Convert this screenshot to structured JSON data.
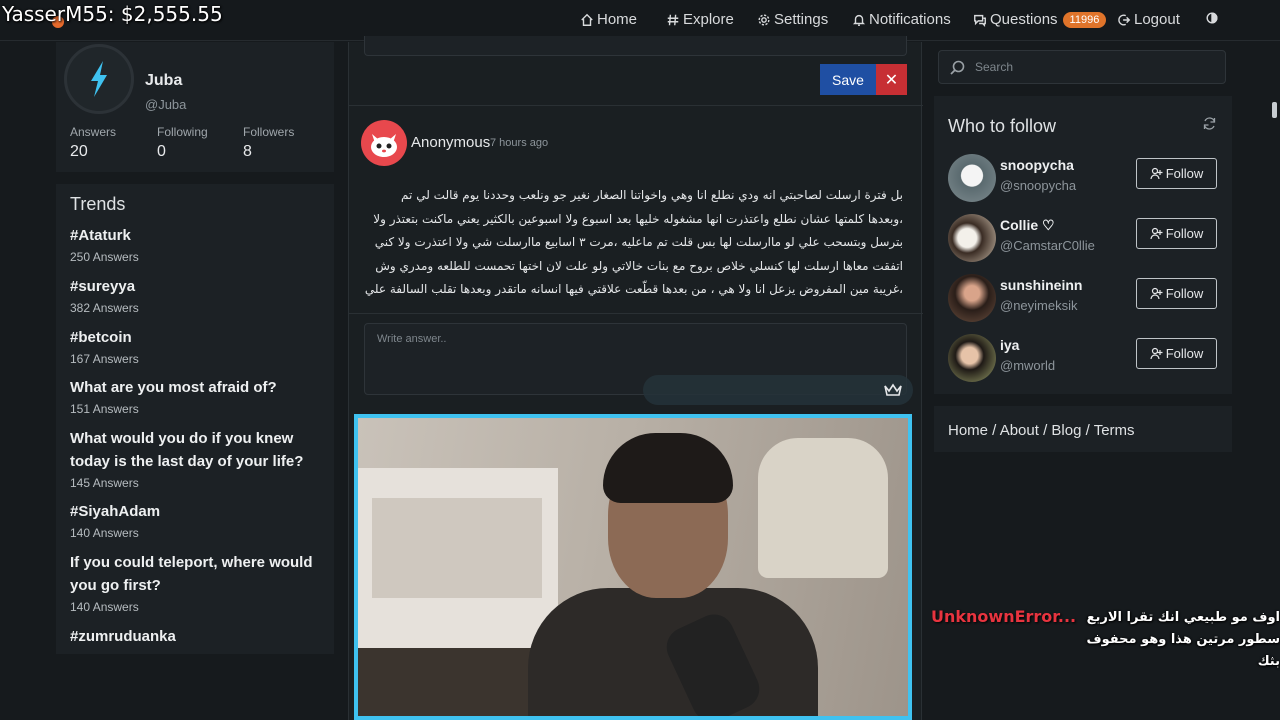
{
  "overlay": {
    "donation_text": "YasserM55: $2,555.55"
  },
  "nav": {
    "home": "Home",
    "explore": "Explore",
    "settings": "Settings",
    "notifications": "Notifications",
    "questions": "Questions",
    "questions_badge": "11996",
    "logout": "Logout"
  },
  "profile": {
    "name": "Juba",
    "handle": "@Juba",
    "stats": [
      {
        "label": "Answers",
        "value": "20"
      },
      {
        "label": "Following",
        "value": "0"
      },
      {
        "label": "Followers",
        "value": "8"
      }
    ]
  },
  "trends": {
    "title": "Trends",
    "items": [
      {
        "title": "#Ataturk",
        "count": "250 Answers"
      },
      {
        "title": "#sureyya",
        "count": "382 Answers"
      },
      {
        "title": "#betcoin",
        "count": "167 Answers"
      },
      {
        "title": "What are you most afraid of?",
        "count": "151 Answers"
      },
      {
        "title": "What would you do if you knew today is the last day of your life?",
        "count": "145 Answers"
      },
      {
        "title": "#SiyahAdam",
        "count": "140 Answers"
      },
      {
        "title": "If you could teleport, where would you go first?",
        "count": "140 Answers"
      },
      {
        "title": "#zumruduanka",
        "count": ""
      }
    ]
  },
  "feed": {
    "save_label": "Save",
    "close_label": "✕",
    "question": {
      "author": "Anonymous",
      "time": "7 hours ago",
      "lines": [
        "بل فترة ارسلت لصاحبتي انه ودي نطلع انا وهي واخواتنا الصغار نغير جو ونلعب وحددنا يوم قالت لي تم",
        "،وبعدها كلمتها عشان نطلع واعتذرت انها مشغوله خليها بعد اسبوع ولا اسبوعين بالكثير يعني ماكنت بتعتذر ولا",
        "بترسل وبتسحب علي لو ماارسلت لها بس قلت تم ماعليه ،مرت ٣ اسابيع ماارسلت شي ولا اعتذرت ولا كني",
        "اتفقت معاها ارسلت لها كنسلي خلاص بروح مع بنات خالاتي ولو علت لان اختها تحمست للطلعه ومدري وش",
        "،غريبة مين المفروض يزعل انا ولا هي ، من بعدها قطّعت علاقتي فيها انسانه ماتقدر وبعدها تقلب السالفة علي"
      ]
    },
    "answer_placeholder": "Write answer.."
  },
  "search": {
    "placeholder": "Search"
  },
  "who_to_follow": {
    "title": "Who to follow",
    "follow_label": "Follow",
    "users": [
      {
        "name": "snoopycha",
        "handle": "@snoopycha"
      },
      {
        "name": "Collie ♡",
        "handle": "@CamstarC0llie"
      },
      {
        "name": "sunshineinn",
        "handle": "@neyimeksik"
      },
      {
        "name": "iya",
        "handle": "@mworld"
      }
    ]
  },
  "footer_links": {
    "home": "Home",
    "about": "About",
    "blog": "Blog",
    "terms": "Terms",
    "separator": " / "
  },
  "chat": {
    "username": "UnknownError...",
    "message": "اوف مو طبيعي انك تقرا الاربع سطور مرتين هذا وهو محفوف بثك"
  },
  "colors": {
    "accent_blue": "#1f4fa3",
    "close_red": "#c72f34",
    "badge_orange": "#e0742a",
    "webcam_border": "#3fc2f0",
    "chat_user": "#e8343f"
  }
}
